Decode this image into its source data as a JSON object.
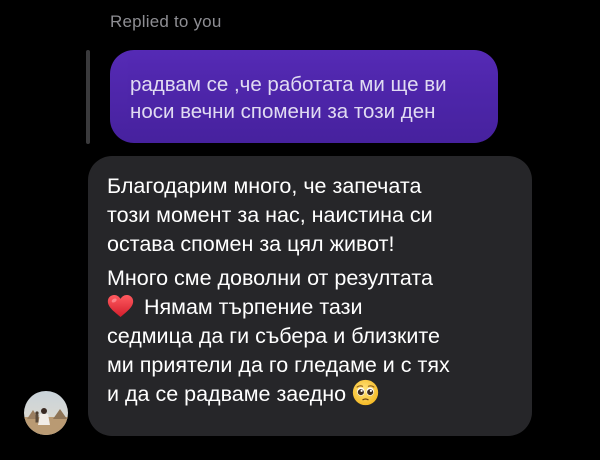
{
  "reply_context": {
    "label": "Replied to you",
    "quoted_lines": [
      "радвам се ,че работата ми ще ви",
      "носи вечни спомени за този ден"
    ]
  },
  "message": {
    "paragraph1_lines": [
      "Благодарим много, че запечата",
      "този момент за нас, наистина си",
      "остава спомен за цял живот!"
    ],
    "paragraph2": {
      "line1": "Много сме доволни от резултата",
      "line2_text": "Нямам търпение тази",
      "line3": "седмица да ги събера и близките",
      "line4": "ми приятели да го гледаме и с тях",
      "line5_text": "и да се радваме заедно"
    },
    "emojis": {
      "heart": "red-heart",
      "face": "pleading-face"
    }
  },
  "colors": {
    "background": "#000000",
    "quoted_bubble": "#5a2dbf",
    "message_bubble": "#262629",
    "muted_text": "#8e8e93"
  }
}
